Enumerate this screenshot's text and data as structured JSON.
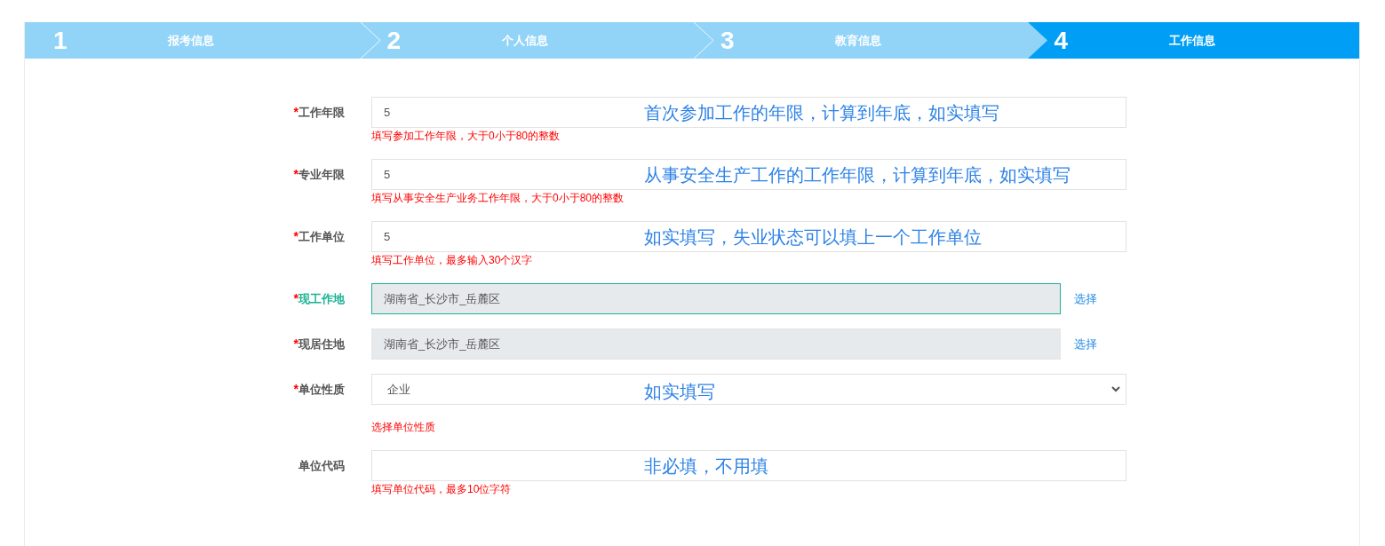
{
  "steps": [
    {
      "number": "1",
      "label": "报考信息",
      "selected": false
    },
    {
      "number": "2",
      "label": "个人信息",
      "selected": false
    },
    {
      "number": "3",
      "label": "教育信息",
      "selected": false
    },
    {
      "number": "4",
      "label": "工作信息",
      "selected": true
    }
  ],
  "fields": [
    {
      "kind": "text",
      "required_mark": "*",
      "focused": false,
      "label": "工作年限",
      "value": "5",
      "hint": "填写参加工作年限，大于0小于80的整数",
      "annotation": "首次参加工作的年限，计算到年底，如实填写"
    },
    {
      "kind": "text",
      "required_mark": "*",
      "focused": false,
      "label": "专业年限",
      "value": "5",
      "hint": "填写从事安全生产业务工作年限，大于0小于80的整数",
      "annotation": "从事安全生产工作的工作年限，计算到年底，如实填写"
    },
    {
      "kind": "text",
      "required_mark": "*",
      "focused": false,
      "label": "工作单位",
      "value": "5",
      "hint": "填写工作单位，最多输入30个汉字",
      "annotation": "如实填写，失业状态可以填上一个工作单位"
    },
    {
      "kind": "picker",
      "required_mark": "*",
      "focused": true,
      "label": "现工作地",
      "value": "湖南省_长沙市_岳麓区",
      "action": "选择"
    },
    {
      "kind": "picker",
      "required_mark": "*",
      "focused": false,
      "label": "现居住地",
      "value": "湖南省_长沙市_岳麓区",
      "action": "选择"
    },
    {
      "kind": "select",
      "required_mark": "*",
      "focused": false,
      "label": "单位性质",
      "value": "企业",
      "hint": "选择单位性质",
      "annotation": "如实填写"
    },
    {
      "kind": "text",
      "focused": false,
      "label": "单位代码",
      "hint": "填写单位代码，最多10位字符",
      "annotation": "非必填，不用填"
    }
  ]
}
